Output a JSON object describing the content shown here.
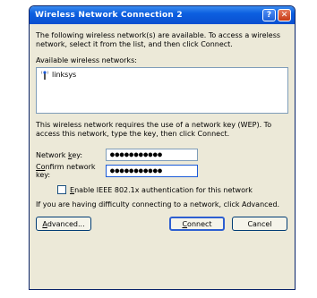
{
  "window": {
    "title": "Wireless Network Connection 2",
    "help_glyph": "?",
    "close_glyph": "✕"
  },
  "intro_text": "The following wireless network(s) are available. To access a wireless network, select it from the list, and then click Connect.",
  "networks_label": "Available wireless networks:",
  "networks": [
    {
      "name": "linksys",
      "icon": "wireless-antenna-icon"
    }
  ],
  "wep_text": "This wireless network requires the use of a network key (WEP). To access this network, type the key, then click Connect.",
  "network_key": {
    "label_pre": "Network ",
    "label_u": "k",
    "label_post": "ey:",
    "value": "●●●●●●●●●●●"
  },
  "confirm_key": {
    "label_u": "Co",
    "label_post": "nfirm network key:",
    "value": "●●●●●●●●●●●"
  },
  "ieee_checkbox": {
    "label_u": "E",
    "label_post": "nable IEEE 802.1x authentication for this network",
    "checked": false
  },
  "help_text": "If you are having difficulty connecting to a network, click Advanced.",
  "buttons": {
    "advanced_u": "A",
    "advanced_post": "dvanced...",
    "connect_u": "C",
    "connect_post": "onnect",
    "cancel": "Cancel"
  },
  "colors": {
    "titlebar": "#0a4fd0",
    "dialog_bg": "#ece9d8",
    "field_border": "#7f9db9"
  }
}
